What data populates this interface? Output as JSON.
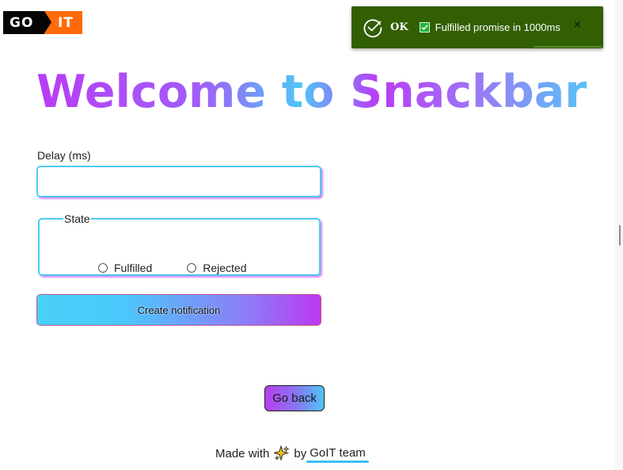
{
  "logo": {
    "left": "GO",
    "right": "IT"
  },
  "toast": {
    "title": "OK",
    "message": "Fulfilled promise in 1000ms",
    "close": "×",
    "status_color": "#325f02",
    "icon": "check-circle-icon"
  },
  "page": {
    "title": "Welcome to Snackbar"
  },
  "form": {
    "delay_label": "Delay (ms)",
    "delay_value": "",
    "state_legend": "State",
    "options": [
      "Fulfilled",
      "Rejected"
    ],
    "submit_label": "Create notification"
  },
  "nav": {
    "back_label": "Go back"
  },
  "footer": {
    "made_with": "Made with",
    "by": "by",
    "team_link": "GoIT team",
    "icon": "sparkle-icon"
  },
  "colors": {
    "accent_cyan": "#4ccbf3",
    "accent_purple": "#b93cf6",
    "logo_orange": "#ff6b08"
  }
}
